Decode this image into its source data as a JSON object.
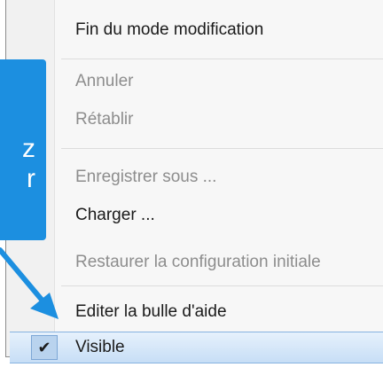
{
  "menu": {
    "items": [
      {
        "label": "Fin du mode modification",
        "enabled": true
      },
      {
        "label": "Annuler",
        "enabled": false
      },
      {
        "label": "Rétablir",
        "enabled": false
      },
      {
        "label": "Enregistrer sous ...",
        "enabled": false
      },
      {
        "label": "Charger ...",
        "enabled": true
      },
      {
        "label": "Restaurer la configuration initiale",
        "enabled": false
      },
      {
        "label": "Editer la bulle d'aide",
        "enabled": true
      },
      {
        "label": "Visible",
        "enabled": true,
        "checked": true,
        "highlighted": true
      }
    ],
    "check_glyph": "✔"
  },
  "callout": {
    "lines": [
      "z",
      "r"
    ],
    "color": "#1c8fe0"
  },
  "colors": {
    "highlight": "#c7def6",
    "accent": "#1c8fe0",
    "disabled_text": "#8d8d8d"
  }
}
